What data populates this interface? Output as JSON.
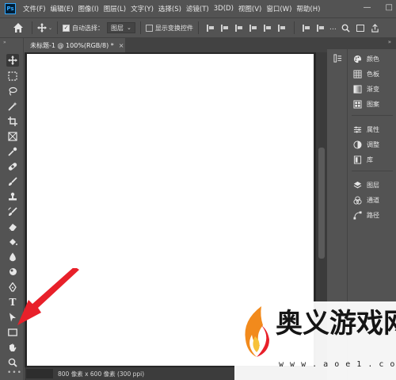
{
  "app": {
    "logo_text": "Ps"
  },
  "menubar": {
    "items": [
      "文件(F)",
      "编辑(E)",
      "图像(I)",
      "图层(L)",
      "文字(Y)",
      "选择(S)",
      "滤镜(T)",
      "3D(D)",
      "视图(V)",
      "窗口(W)",
      "帮助(H)"
    ],
    "window_controls": {
      "minimize": "—",
      "maximize": "□"
    }
  },
  "options": {
    "auto_select_label": "自动选择：",
    "auto_select_checked": true,
    "layer_select_value": "图层",
    "show_transform_label": "显示变换控件",
    "show_transform_checked": false
  },
  "document_tab": {
    "title": "未标题-1 @ 100%(RGB/8) *",
    "close": "×"
  },
  "status": {
    "info": "800 像素 x 600 像素 (300 ppi)",
    "more": "•••"
  },
  "toolbar": {
    "collapse": "»",
    "tools": [
      "move-tool",
      "marquee-tool",
      "lasso-tool",
      "magic-wand-tool",
      "crop-tool",
      "frame-tool",
      "eyedropper-tool",
      "healing-brush-tool",
      "brush-tool",
      "clone-stamp-tool",
      "history-brush-tool",
      "eraser-tool",
      "paint-bucket-tool",
      "blur-tool",
      "dodge-tool",
      "pen-tool",
      "type-tool",
      "path-selection-tool",
      "rectangle-tool",
      "hand-tool",
      "zoom-tool"
    ],
    "type_glyph": "T"
  },
  "panels": {
    "collapse": "»",
    "groups": [
      {
        "items": [
          {
            "icon": "palette-icon",
            "label": "颜色"
          },
          {
            "icon": "swatches-icon",
            "label": "色板"
          },
          {
            "icon": "gradient-icon",
            "label": "渐变"
          },
          {
            "icon": "patterns-icon",
            "label": "图案"
          }
        ]
      },
      {
        "items": [
          {
            "icon": "properties-icon",
            "label": "属性"
          },
          {
            "icon": "adjustments-icon",
            "label": "调整"
          },
          {
            "icon": "libraries-icon",
            "label": "库"
          }
        ]
      },
      {
        "items": [
          {
            "icon": "layers-icon",
            "label": "图层"
          },
          {
            "icon": "channels-icon",
            "label": "通道"
          },
          {
            "icon": "paths-icon",
            "label": "路径"
          }
        ]
      }
    ]
  },
  "watermark": {
    "title": "奥义游戏网",
    "url": "w w w . a o e 1 . c o m"
  },
  "colors": {
    "ui_bg": "#535353",
    "dark_bg": "#282828",
    "canvas": "#ffffff",
    "annotation_arrow": "#e8202a"
  }
}
